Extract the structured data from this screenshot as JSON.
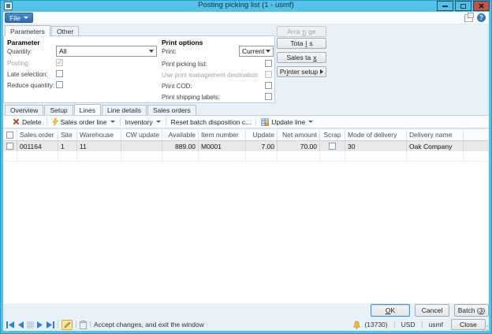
{
  "window": {
    "title": "Posting picking list (1 - usmf)"
  },
  "menubar": {
    "file": "File"
  },
  "param_tabs": {
    "items": [
      "Parameters",
      "Other"
    ],
    "active": "Parameters"
  },
  "parameter_group": {
    "title": "Parameter",
    "quantity_label": "Quantity:",
    "quantity_value": "All",
    "posting_label": "Posting:",
    "posting_checked": true,
    "late_selection_label": "Late selection:",
    "reduce_quantity_label": "Reduce quantity:"
  },
  "print_options": {
    "title": "Print options",
    "print_label": "Print:",
    "print_value": "Current",
    "print_picking_list_label": "Print picking list:",
    "use_print_mgmt_label": "Use print management destination:",
    "print_cod_label": "Print COD:",
    "print_shipping_labels_label": "Print shipping labels:"
  },
  "side_buttons": {
    "arrange": "Arrange",
    "totals": "Totals",
    "sales_tax": "Sales tax",
    "printer_setup": "Printer setup"
  },
  "main_tabs": {
    "items": [
      "Overview",
      "Setup",
      "Lines",
      "Line details",
      "Sales orders"
    ],
    "active": "Lines"
  },
  "toolbar": {
    "delete": "Delete",
    "sales_order_line": "Sales order line",
    "inventory": "Inventory",
    "reset_batch": "Reset batch disposition c...",
    "update_line": "Update line"
  },
  "grid": {
    "columns": [
      "Sales order",
      "Site",
      "Warehouse",
      "CW update",
      "Available",
      "Item number",
      "Update",
      "Net amount",
      "Scrap",
      "Mode of delivery",
      "Delivery name"
    ],
    "row": {
      "sales_order": "001164",
      "site": "1",
      "warehouse": "11",
      "cw_update": "",
      "available": "889.00",
      "item_number": "M0001",
      "update": "7.00",
      "net_amount": "70.00",
      "mode_of_delivery": "30",
      "delivery_name": "Oak Company"
    }
  },
  "footer": {
    "ok": "OK",
    "cancel": "Cancel",
    "batch": "Batch (3)"
  },
  "statusbar": {
    "message": "Accept changes, and exit the window",
    "notifications": "(13730)",
    "currency": "USD",
    "company": "usmf",
    "close": "Close"
  }
}
